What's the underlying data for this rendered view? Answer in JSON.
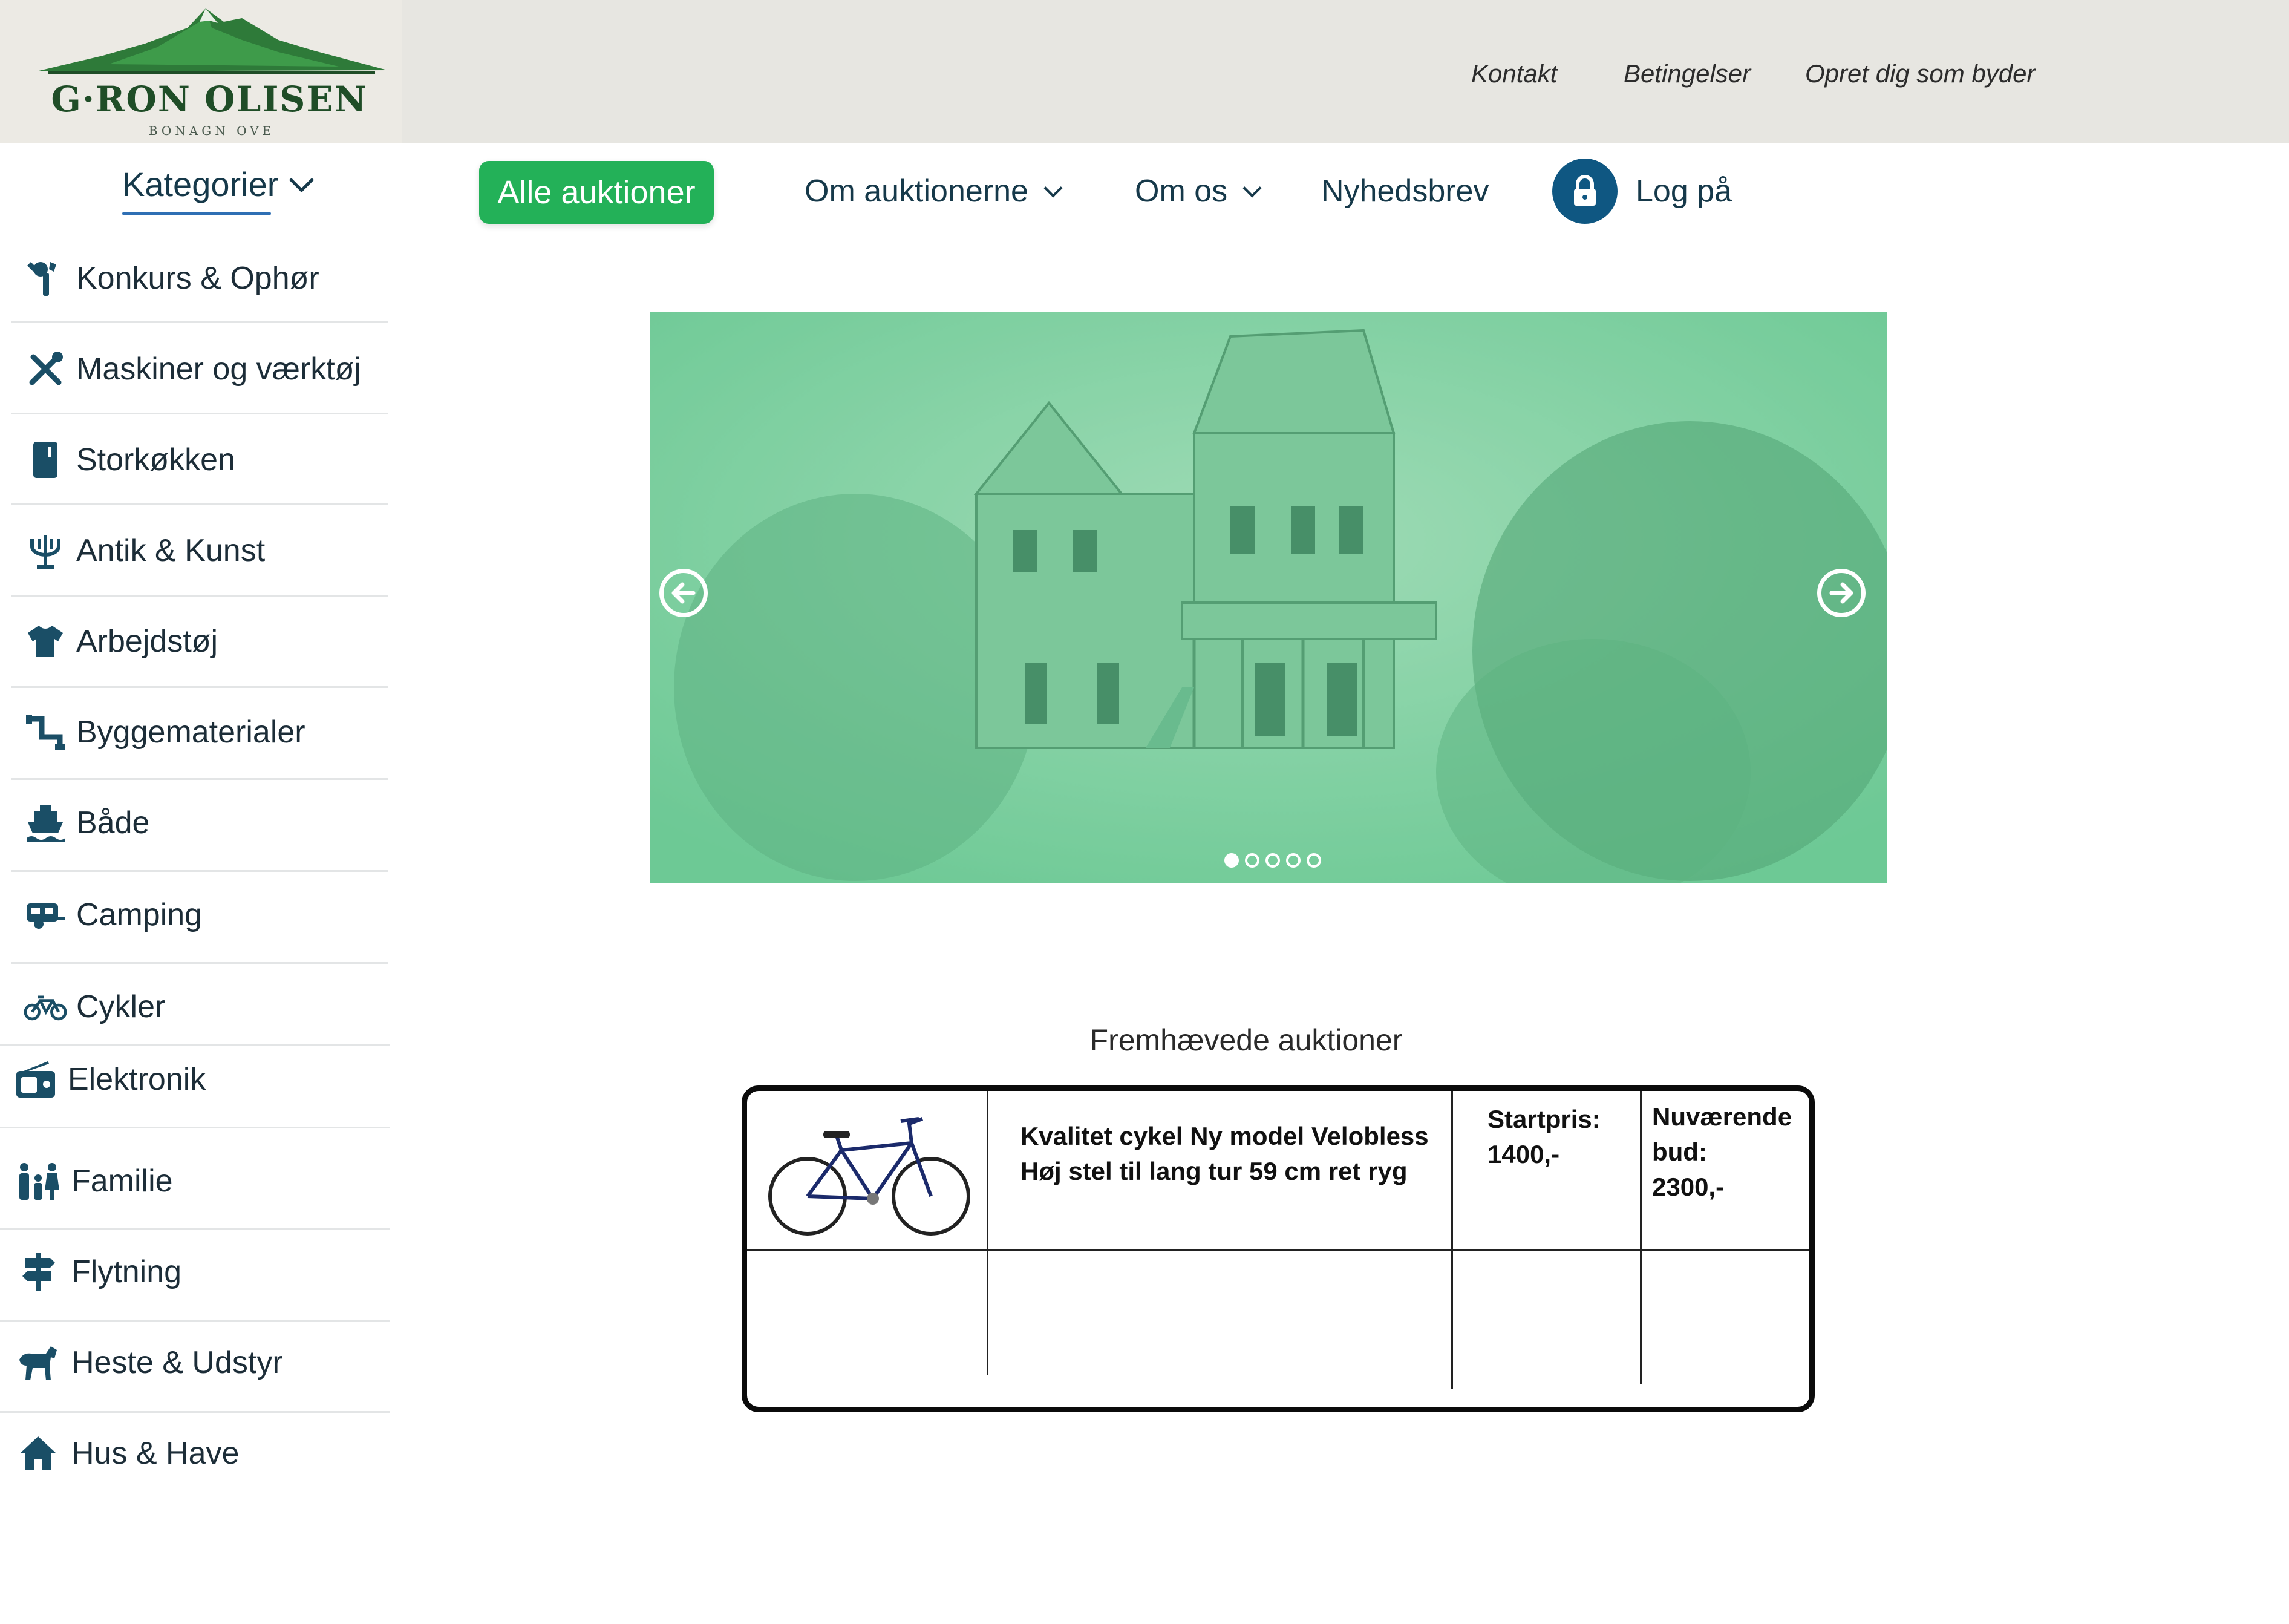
{
  "brand": {
    "name": "G·RON OLISEN",
    "tagline": "BONAGN OVE",
    "colors": {
      "mountain": "#2e7a39",
      "text": "#1f4d27"
    }
  },
  "top_links": [
    "Kontakt",
    "Betingelser",
    "Opret dig som byder"
  ],
  "nav": {
    "categories_toggle": "Kategorier",
    "all_auctions": "Alle auktioner",
    "about_auctions": "Om auktionerne",
    "about_us": "Om os",
    "newsletter": "Nyhedsbrev",
    "login": "Log på",
    "accent_color": "#23b158"
  },
  "categories": [
    {
      "label": "Konkurs & Ophør",
      "icon": "auction-hammer-icon"
    },
    {
      "label": "Maskiner og værktøj",
      "icon": "tools-icon"
    },
    {
      "label": "Storkøkken",
      "icon": "fridge-icon"
    },
    {
      "label": "Antik & Kunst",
      "icon": "candelabra-icon"
    },
    {
      "label": "Arbejdstøj",
      "icon": "shirt-icon"
    },
    {
      "label": "Byggematerialer",
      "icon": "pipe-icon"
    },
    {
      "label": "Både",
      "icon": "boat-icon"
    },
    {
      "label": "Camping",
      "icon": "caravan-icon"
    },
    {
      "label": "Cykler",
      "icon": "bicycle-icon"
    },
    {
      "label": "Elektronik",
      "icon": "radio-icon"
    },
    {
      "label": "Familie",
      "icon": "family-icon"
    },
    {
      "label": "Flytning",
      "icon": "signpost-icon"
    },
    {
      "label": "Heste & Udstyr",
      "icon": "horse-icon"
    },
    {
      "label": "Hus & Have",
      "icon": "house-icon"
    }
  ],
  "carousel": {
    "slide_count": 5,
    "active_slide": 1,
    "tint": "#7fd3a4"
  },
  "featured": {
    "title": "Fremhævede auktioner",
    "items": [
      {
        "title_line1": "Kvalitet cykel Ny model Velobless",
        "title_line2": "Høj stel til lang tur 59 cm ret ryg",
        "start_label": "Startpris:",
        "start_value": "1400,-",
        "bid_label_1": "Nuværende",
        "bid_label_2": "bud:",
        "bid_value": "2300,-"
      }
    ]
  }
}
